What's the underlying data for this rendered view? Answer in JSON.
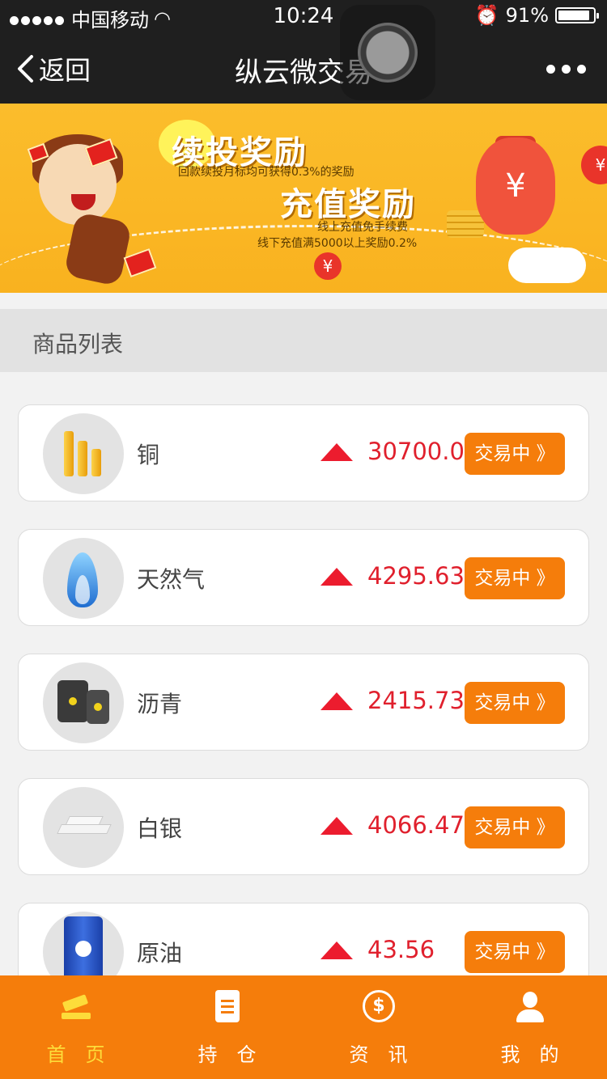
{
  "status_bar": {
    "carrier": "中国移动",
    "time": "10:24",
    "battery": "91%",
    "battery_level": 0.91
  },
  "nav": {
    "back_label": "返回",
    "title": "纵云微交易"
  },
  "banner": {
    "headline_1": "续投奖励",
    "sub_1": "回款续投月标均可获得0.3%的奖励",
    "headline_2": "充值奖励",
    "sub_2": "线上充值免手续费",
    "sub_3": "线下充值满5000以上奖励0.2%"
  },
  "section": {
    "title": "商品列表"
  },
  "products": [
    {
      "name": "铜",
      "price": "30700.03",
      "status": "交易中 》",
      "icon": "copper-icon",
      "trend": "up"
    },
    {
      "name": "天然气",
      "price": "4295.63",
      "status": "交易中 》",
      "icon": "natural-gas-icon",
      "trend": "up"
    },
    {
      "name": "沥青",
      "price": "2415.73",
      "status": "交易中 》",
      "icon": "asphalt-icon",
      "trend": "up"
    },
    {
      "name": "白银",
      "price": "4066.47",
      "status": "交易中 》",
      "icon": "silver-icon",
      "trend": "up"
    },
    {
      "name": "原油",
      "price": "43.56",
      "status": "交易中 》",
      "icon": "crude-oil-icon",
      "trend": "up"
    }
  ],
  "tabs": [
    {
      "label": "首页",
      "icon": "auction-hammer-icon",
      "active": true
    },
    {
      "label": "持仓",
      "icon": "clipboard-icon",
      "active": false
    },
    {
      "label": "资讯",
      "icon": "dollar-globe-icon",
      "active": false
    },
    {
      "label": "我的",
      "icon": "user-icon",
      "active": false
    }
  ],
  "colors": {
    "accent": "#f57d0b",
    "price_up": "#e0202d",
    "nav_bg": "#1f1f1f",
    "active_tab": "#fddc3a"
  }
}
